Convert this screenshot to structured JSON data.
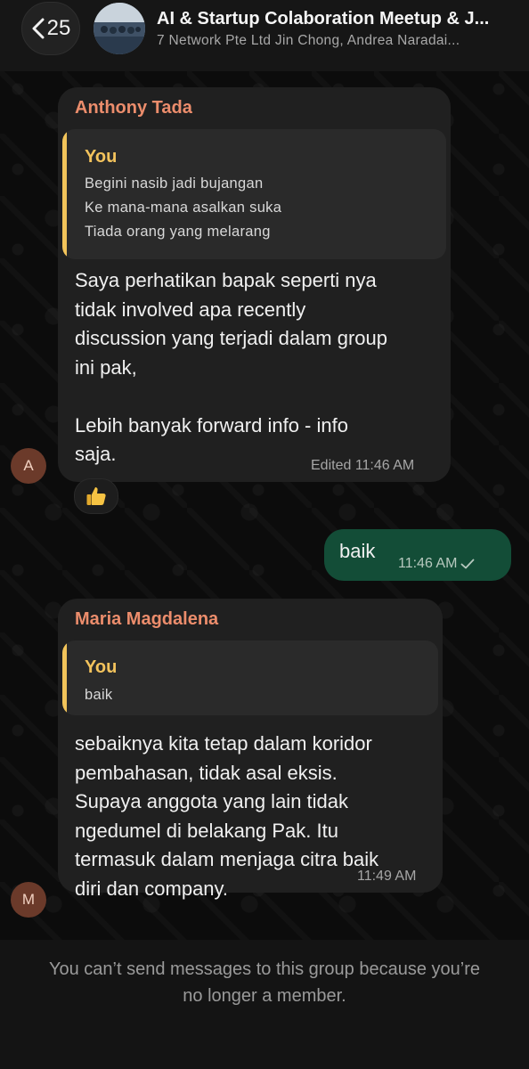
{
  "header": {
    "back_count": "25",
    "title": "AI & Startup Colaboration Meetup & J...",
    "subtitle": "7 Network Pte Ltd Jin Chong, Andrea Naradai..."
  },
  "messages": [
    {
      "sender": "Anthony Tada",
      "avatar_letter": "A",
      "quote": {
        "author": "You",
        "lines": [
          "Begini nasib jadi bujangan",
          "Ke mana-mana asalkan suka",
          "Tiada orang yang melarang"
        ]
      },
      "text": "Saya perhatikan bapak seperti nya\ntidak involved apa recently\ndiscussion yang terjadi dalam group\nini pak,\n\nLebih banyak forward info - info\nsaja.",
      "meta": "Edited 11:46 AM",
      "reaction": "thumbs-up"
    },
    {
      "outgoing": true,
      "text": "baik",
      "meta": "11:46 AM"
    },
    {
      "sender": "Maria Magdalena",
      "avatar_letter": "M",
      "quote": {
        "author": "You",
        "lines": [
          "baik"
        ]
      },
      "text": "sebaiknya kita tetap dalam koridor\npembahasan, tidak asal eksis.\nSupaya anggota yang lain tidak\nngedumel di belakang Pak. Itu\ntermasuk dalam menjaga citra baik\ndiri dan company.",
      "meta": "11:49 AM"
    }
  ],
  "footer": {
    "notice": "You can’t send messages to this group because you’re no longer a member."
  },
  "colors": {
    "sender_name": "#ec8d6c",
    "quote_accent": "#f2c45a",
    "outgoing_bubble": "#134d37",
    "incoming_bubble": "#202020"
  }
}
